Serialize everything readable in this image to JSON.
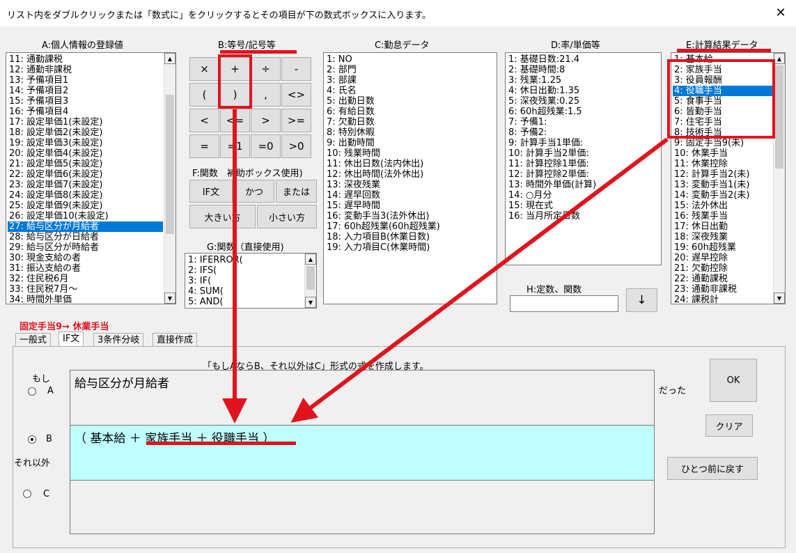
{
  "window": {
    "title": "リスト内をダブルクリックまたは「数式に」をクリックするとその項目が下の数式ボックスに入ります。",
    "close_glyph": "✕"
  },
  "panels": {
    "a": {
      "label": "A:個人情報の登録値",
      "items": [
        "11: 通勤課税",
        "12: 通勤非課税",
        "13: 予備項目1",
        "14: 予備項目2",
        "15: 予備項目3",
        "16: 予備項目4",
        "17: 設定単価1(未設定)",
        "18: 設定単価2(未設定)",
        "19: 設定単価3(未設定)",
        "20: 設定単価4(未設定)",
        "21: 設定単価5(未設定)",
        "22: 設定単価6(未設定)",
        "23: 設定単価7(未設定)",
        "24: 設定単価8(未設定)",
        "25: 設定単価9(未設定)",
        "26: 設定単価10(未設定)",
        "27: 給与区分が月給者",
        "28: 給与区分が日給者",
        "29: 給与区分が時給者",
        "30: 現金支給の者",
        "31: 振込支給の者",
        "32: 住民税6月",
        "33: 住民税7月～",
        "34: 時間外単価"
      ],
      "selected": "27: 給与区分が月給者"
    },
    "b": {
      "label": "B:等号/記号等",
      "buttons": [
        "×",
        "+",
        "÷",
        "-",
        "(",
        ")",
        ",",
        "<>",
        "<",
        "<=",
        ">",
        ">=",
        "=",
        "=1",
        "=0",
        ">0"
      ]
    },
    "f": {
      "label": "F:関数　補助ボックス使用)",
      "buttons": [
        "IF文",
        "かつ",
        "または",
        "大きい方",
        "小さい方"
      ]
    },
    "g": {
      "label": "G:関数（直接使用)",
      "items": [
        "1: IFERROR(",
        "2: IFS(",
        "3: IF(",
        "4: SUM(",
        "5: AND("
      ]
    },
    "c": {
      "label": "C:勤怠データ",
      "items": [
        "1: NO",
        "2: 部門",
        "3: 部課",
        "4: 氏名",
        "5: 出勤日数",
        "6: 有給日数",
        "7: 欠勤日数",
        "8: 特別休暇",
        "9: 出勤時間",
        "10: 残業時間",
        "11: 休出日数(法内休出)",
        "12: 休出時間(法外休出)",
        "13: 深夜残業",
        "14: 遅早回数",
        "15: 遅早時間",
        "16: 変動手当3(法外休出)",
        "17: 60h超残業(60h超残業)",
        "18: 入力項目B(休業日数)",
        "19: 入力項目C(休業時間)"
      ]
    },
    "d": {
      "label": "D:率/単価等",
      "items": [
        "1: 基礎日数:21.4",
        "2: 基礎時間:8",
        "3: 残業:1.25",
        "4: 休日出勤:1.35",
        "5: 深夜残業:0.25",
        "6: 60h超残業:1.5",
        "7: 予備1:",
        "8: 予備2:",
        "9: 計算手当1単価:",
        "10: 計算手当2単価:",
        "11: 計算控除1単価:",
        "12: 計算控除2単価:",
        "13: 時間外単価(計算)",
        "14: ○月分",
        "15: 現在式",
        "16: 当月所定日数"
      ]
    },
    "h": {
      "label": "H:定数、関数",
      "value": "",
      "arrow": "↓"
    },
    "e": {
      "label": "E:計算結果データ",
      "items": [
        "1: 基本給",
        "2: 家族手当",
        "3: 役員報酬",
        "4: 役職手当",
        "5: 食事手当",
        "6: 皆勤手当",
        "7: 住宅手当",
        "8: 技術手当",
        "9: 固定手当9(未)",
        "10: 休業手当",
        "11: 休業控除",
        "12: 計算手当2(未)",
        "13: 変動手当1(未)",
        "14: 変動手当2(未)",
        "15: 法外休出",
        "16: 残業手当",
        "17: 休日出勤",
        "18: 深夜残業",
        "19: 60h超残業",
        "20: 遅早控除",
        "21: 欠勤控除",
        "22: 通勤課税",
        "23: 通勤非課税",
        "24: 課税計"
      ],
      "selected": "4: 役職手当"
    }
  },
  "target": {
    "text": "固定手当9→ 休業手当"
  },
  "tabs": [
    "一般式",
    "IF文",
    "3条件分岐",
    "直接作成"
  ],
  "active_tab": "IF文",
  "ifpanel": {
    "instruction": "「もしAならB、それ以外はC」形式の式を作成します。",
    "moshi": "もし",
    "a_label": "A",
    "b_label": "B",
    "c_label": "C",
    "soreigai": "それ以外",
    "datta": "だった",
    "field_a": "給与区分が月給者",
    "field_b": "（ 基本給 ＋ 家族手当 ＋ 役職手当 ）",
    "field_c": "",
    "selected_radio": "B"
  },
  "actions": {
    "ok": "OK",
    "clear": "クリア",
    "undo": "ひとつ前に戻す"
  },
  "colors": {
    "annotation": "#e0141e",
    "selection": "#0078d7",
    "field_b_bg": "#c0ffff"
  }
}
